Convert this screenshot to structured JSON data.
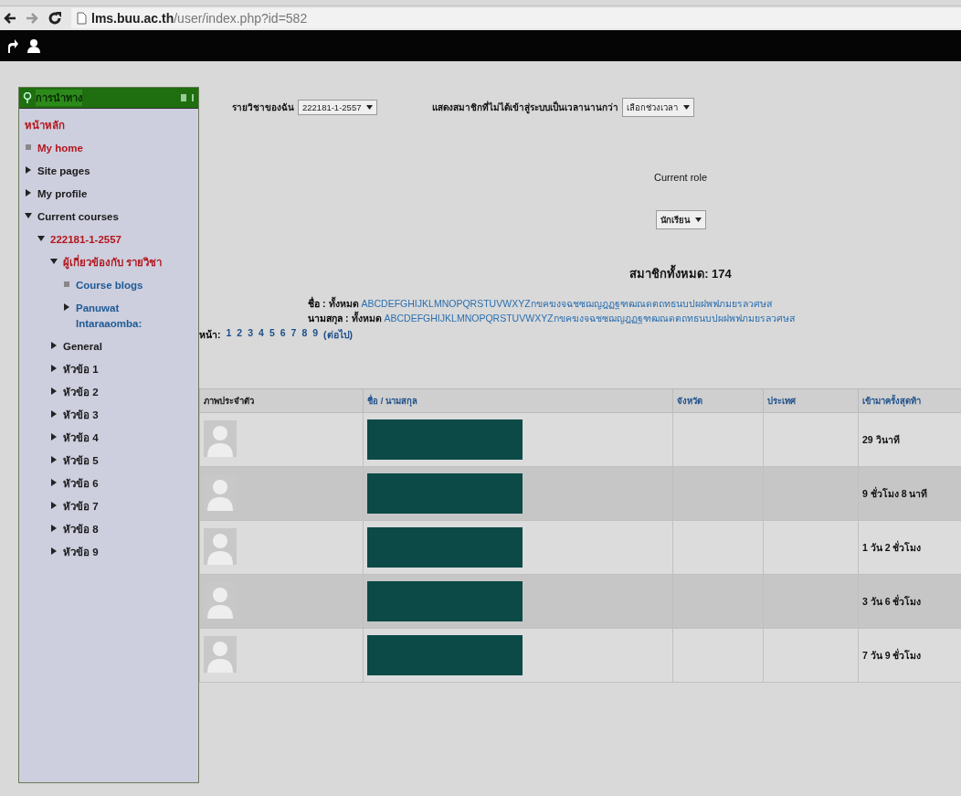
{
  "browser": {
    "url_domain": "lms.buu.ac.th",
    "url_path": "/user/index.php?id=582"
  },
  "navigation": {
    "title": "การนำทาง",
    "items": [
      {
        "label": "หน้าหลัก",
        "kind": "root",
        "color": "#b3161c"
      },
      {
        "label": "My home",
        "kind": "leaf",
        "color": "#b3161c"
      },
      {
        "label": "Site pages",
        "kind": "branch",
        "expanded": false,
        "color": "#1a1a1a"
      },
      {
        "label": "My profile",
        "kind": "branch",
        "expanded": false,
        "color": "#1a1a1a"
      },
      {
        "label": "Current courses",
        "kind": "branch",
        "expanded": true,
        "color": "#1a1a1a",
        "children": [
          {
            "label": "222181-1-2557",
            "kind": "branch",
            "expanded": true,
            "color": "#b3161c",
            "children": [
              {
                "label": "ผู้เกี่ยวข้องกับ รายวิชา",
                "kind": "branch",
                "expanded": true,
                "color": "#b3161c",
                "children": [
                  {
                    "label": "Course blogs",
                    "kind": "leaf",
                    "color": "#1d5a94"
                  },
                  {
                    "label": "Panuwat Intaraaomba:",
                    "kind": "branch",
                    "expanded": false,
                    "color": "#1d5a94"
                  }
                ]
              },
              {
                "label": "General",
                "kind": "branch",
                "expanded": false,
                "color": "#1a1a1a"
              },
              {
                "label": "หัวข้อ 1",
                "kind": "branch",
                "expanded": false,
                "color": "#1a1a1a"
              },
              {
                "label": "หัวข้อ 2",
                "kind": "branch",
                "expanded": false,
                "color": "#1a1a1a"
              },
              {
                "label": "หัวข้อ 3",
                "kind": "branch",
                "expanded": false,
                "color": "#1a1a1a"
              },
              {
                "label": "หัวข้อ 4",
                "kind": "branch",
                "expanded": false,
                "color": "#1a1a1a"
              },
              {
                "label": "หัวข้อ 5",
                "kind": "branch",
                "expanded": false,
                "color": "#1a1a1a"
              },
              {
                "label": "หัวข้อ 6",
                "kind": "branch",
                "expanded": false,
                "color": "#1a1a1a"
              },
              {
                "label": "หัวข้อ 7",
                "kind": "branch",
                "expanded": false,
                "color": "#1a1a1a"
              },
              {
                "label": "หัวข้อ 8",
                "kind": "branch",
                "expanded": false,
                "color": "#1a1a1a"
              },
              {
                "label": "หัวข้อ 9",
                "kind": "branch",
                "expanded": false,
                "color": "#1a1a1a"
              }
            ]
          }
        ]
      }
    ]
  },
  "filters": [
    {
      "label": "รายวิชาของฉัน",
      "value": "222181-1-2557"
    },
    {
      "label": "แสดงสมาชิกที่ไม่ได้เข้าสู่ระบบเป็นเวลานานกว่า",
      "value": "เลือกช่วงเวลา"
    }
  ],
  "role": {
    "label": "Current role",
    "value": "นักเรียน"
  },
  "total": "สมาชิกทั้งหมด: 174",
  "initials": [
    {
      "label": "ชื่อ :",
      "all": "ทั้งหมด",
      "letters": [
        "A",
        "B",
        "C",
        "D",
        "E",
        "F",
        "G",
        "H",
        "I",
        "J",
        "K",
        "L",
        "M",
        "N",
        "O",
        "P",
        "Q",
        "R",
        "S",
        "T",
        "U",
        "V",
        "W",
        "X",
        "Y",
        "Z",
        "ก",
        "ข",
        "ค",
        "ฆ",
        "ง",
        "จ",
        "ฉ",
        "ช",
        "ซ",
        "ฌ",
        "ญ",
        "ฎ",
        "ฏ",
        "ฐ",
        "ฑ",
        "ฒ",
        "ณ",
        "ด",
        "ต",
        "ถ",
        "ท",
        "ธ",
        "น",
        "บ",
        "ป",
        "ผ",
        "ฝ",
        "พ",
        "ฟ",
        "ภ",
        "ม",
        "ย",
        "ร",
        "ล",
        "ว",
        "ศ",
        "ษ",
        "ส"
      ]
    },
    {
      "label": "นามสกุล :",
      "all": "ทั้งหมด",
      "letters": [
        "A",
        "B",
        "C",
        "D",
        "E",
        "F",
        "G",
        "H",
        "I",
        "J",
        "K",
        "L",
        "M",
        "N",
        "O",
        "P",
        "Q",
        "R",
        "S",
        "T",
        "U",
        "V",
        "W",
        "X",
        "Y",
        "Z",
        "ก",
        "ข",
        "ค",
        "ฆ",
        "ง",
        "จ",
        "ฉ",
        "ช",
        "ซ",
        "ฌ",
        "ญ",
        "ฎ",
        "ฏ",
        "ฐ",
        "ฑ",
        "ฒ",
        "ณ",
        "ด",
        "ต",
        "ถ",
        "ท",
        "ธ",
        "น",
        "บ",
        "ป",
        "ผ",
        "ฝ",
        "พ",
        "ฟ",
        "ภ",
        "ม",
        "ย",
        "ร",
        "ล",
        "ว",
        "ศ",
        "ษ",
        "ส"
      ]
    }
  ],
  "pager": {
    "label": "หน้า:",
    "pages": [
      "1",
      "2",
      "3",
      "4",
      "5",
      "6",
      "7",
      "8",
      "9"
    ],
    "next": "(ต่อไป)"
  },
  "table": {
    "columns": [
      "ภาพประจำตัว",
      "ชื่อ / นามสกุล",
      "จังหวัด",
      "ประเทศ",
      "เข้ามาครั้งสุดท้า"
    ],
    "rows": [
      {
        "last_access": "29 วินาที"
      },
      {
        "last_access": "9 ชั่วโมง 8 นาที"
      },
      {
        "last_access": "1 วัน 2 ชั่วโมง"
      },
      {
        "last_access": "3 วัน 6 ชั่วโมง"
      },
      {
        "last_access": "7 วัน 9 ชั่วโมง"
      }
    ]
  }
}
